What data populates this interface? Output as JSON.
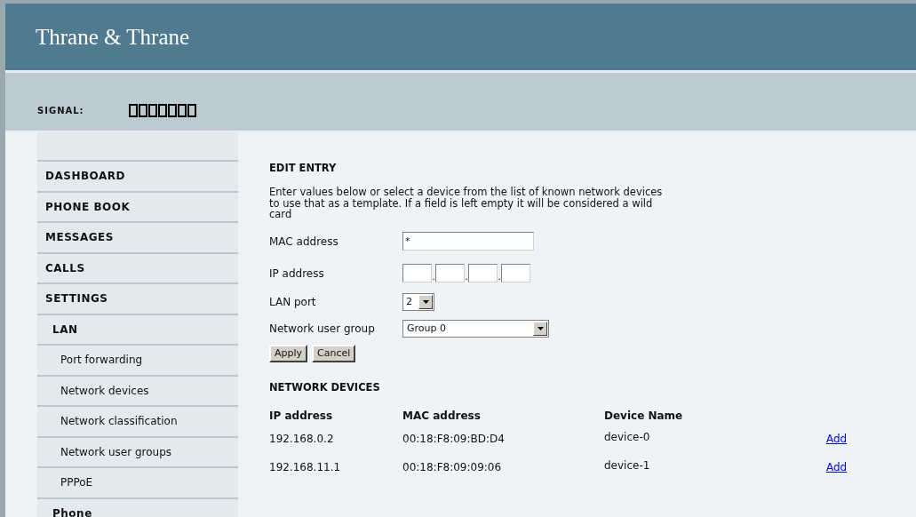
{
  "header": {
    "brand": "Thrane & Thrane"
  },
  "signal_bar": {
    "label": "SIGNAL:"
  },
  "sidebar": {
    "items": [
      {
        "label": "DASHBOARD",
        "kind": "top"
      },
      {
        "label": "PHONE BOOK",
        "kind": "top"
      },
      {
        "label": "MESSAGES",
        "kind": "top"
      },
      {
        "label": "CALLS",
        "kind": "top"
      },
      {
        "label": "SETTINGS",
        "kind": "top"
      },
      {
        "label": "LAN",
        "kind": "section"
      },
      {
        "label": "Port forwarding",
        "kind": "page"
      },
      {
        "label": "Network devices",
        "kind": "page"
      },
      {
        "label": "Network classification",
        "kind": "page"
      },
      {
        "label": "Network user groups",
        "kind": "page"
      },
      {
        "label": "PPPoE",
        "kind": "page"
      },
      {
        "label": "Phone",
        "kind": "section"
      }
    ]
  },
  "edit_entry": {
    "title": "EDIT ENTRY",
    "intro": "Enter values below or select a device from the list of known network devices to use that as a template. If a field is left empty it will be considered a wild card",
    "mac_address": {
      "label": "MAC address",
      "value": "*"
    },
    "ip_address": {
      "label": "IP address",
      "separators": [
        ".",
        ".",
        "."
      ]
    },
    "lan_port": {
      "label": "LAN port",
      "value": "2"
    },
    "network_user_group": {
      "label": "Network user group",
      "value": "Group 0"
    },
    "buttons": [
      "Apply",
      "Cancel"
    ]
  },
  "network_devices": {
    "title": "NETWORK DEVICES",
    "columns": [
      "IP address",
      "MAC address",
      "Device Name"
    ],
    "rows": [
      {
        "ip": "192.168.0.2",
        "mac": "00:18:F8:09:BD:D4",
        "name": "device-0",
        "action": "Add"
      },
      {
        "ip": "192.168.11.1",
        "mac": "00:18:F8:09:09:06",
        "name": "device-1",
        "action": "Add"
      }
    ]
  }
}
